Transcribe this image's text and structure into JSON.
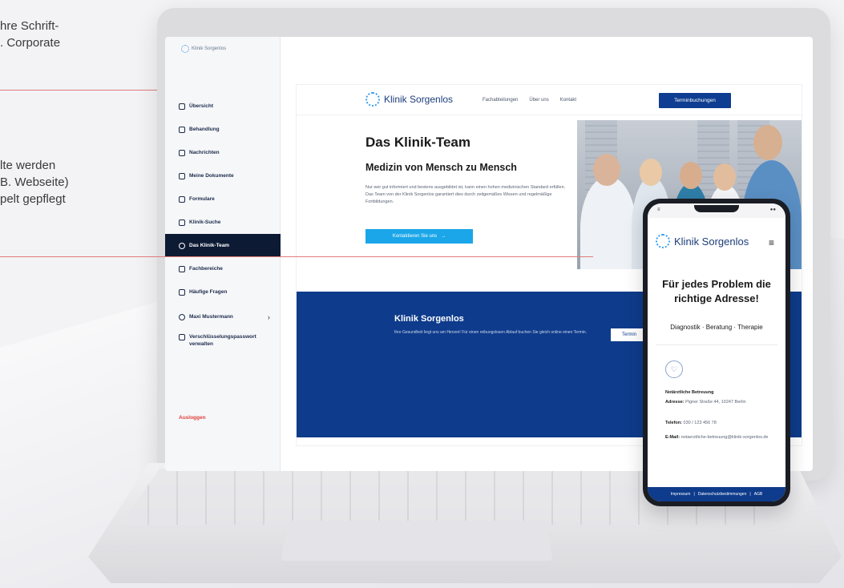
{
  "marketing": {
    "line1": "hre Schrift-",
    "line2": ". Corporate",
    "line3": "lte werden",
    "line4": "B. Webseite)",
    "line5": "pelt gepflegt"
  },
  "sidebar": {
    "logo": "Klinik Sorgenlos",
    "items": [
      {
        "label": "Übersicht",
        "icon": "home-icon"
      },
      {
        "label": "Behandlung",
        "icon": "calendar-icon"
      },
      {
        "label": "Nachrichten",
        "icon": "chat-icon"
      },
      {
        "label": "Meine Dokumente",
        "icon": "folder-icon"
      },
      {
        "label": "Formulare",
        "icon": "clipboard-icon"
      },
      {
        "label": "Klinik-Suche",
        "icon": "hospital-icon"
      },
      {
        "label": "Das Klinik-Team",
        "icon": "team-icon"
      },
      {
        "label": "Fachbereiche",
        "icon": "grid-icon"
      },
      {
        "label": "Häufige Fragen",
        "icon": "question-icon"
      }
    ],
    "user": "Maxi Mustermann",
    "user_chevron": "›",
    "password": "Verschlüsselungspasswort verwalten",
    "logout": "Ausloggen"
  },
  "website": {
    "brand": "Klinik Sorgenlos",
    "links": [
      "Fachabteilungen",
      "Über uns",
      "Kontakt"
    ],
    "cta": "Terminbuchungen",
    "hero_title": "Das Klinik-Team",
    "hero_subtitle": "Medizin von Mensch zu Mensch",
    "hero_body": "Nur wer gut informiert und bestens ausgebildet ist, kann einen hohen medizinischen Standard erfüllen. Das Team von der Klinik Sorgenlos garantiert dies durch zeitgemäßes Wissen und regelmäßige Fortbildungen.",
    "hero_button": "Kontaktieren Sie uns",
    "hero_button_arrow": "→",
    "band_title": "Klinik Sorgenlos",
    "band_text": "Ihre Gesundheit liegt uns am Herzen! Für einen reibungslosen Ablauf buchen Sie gleich online einen Termin.",
    "band_button": "Termin"
  },
  "phone": {
    "status_left": "≡",
    "status_right": "●●",
    "brand": "Klinik Sorgenlos",
    "menu": "≡",
    "headline": "Für jedes Problem die richtige Adresse!",
    "subline": "Diagnostik · Beratung · Therapie",
    "service_title": "Notärztliche Betreuung",
    "address_label": "Adresse:",
    "address_value": "Pigner Straße 44, 10247 Berlin",
    "phone_label": "Telefon:",
    "phone_value": "030 / 123 456 78",
    "email_label": "E-Mail:",
    "email_value": "notaerztliche-betreuung@klinik-sorgenlos.de",
    "footer": [
      "Impressum",
      "Datenschutzbestimmungen",
      "AGB"
    ]
  },
  "colors": {
    "navy": "#0e3b8b",
    "sidebar_active": "#0d1a34",
    "accent_cyan": "#1aa6e8",
    "logout_red": "#e0413a",
    "callout_line": "#e17b7b"
  }
}
